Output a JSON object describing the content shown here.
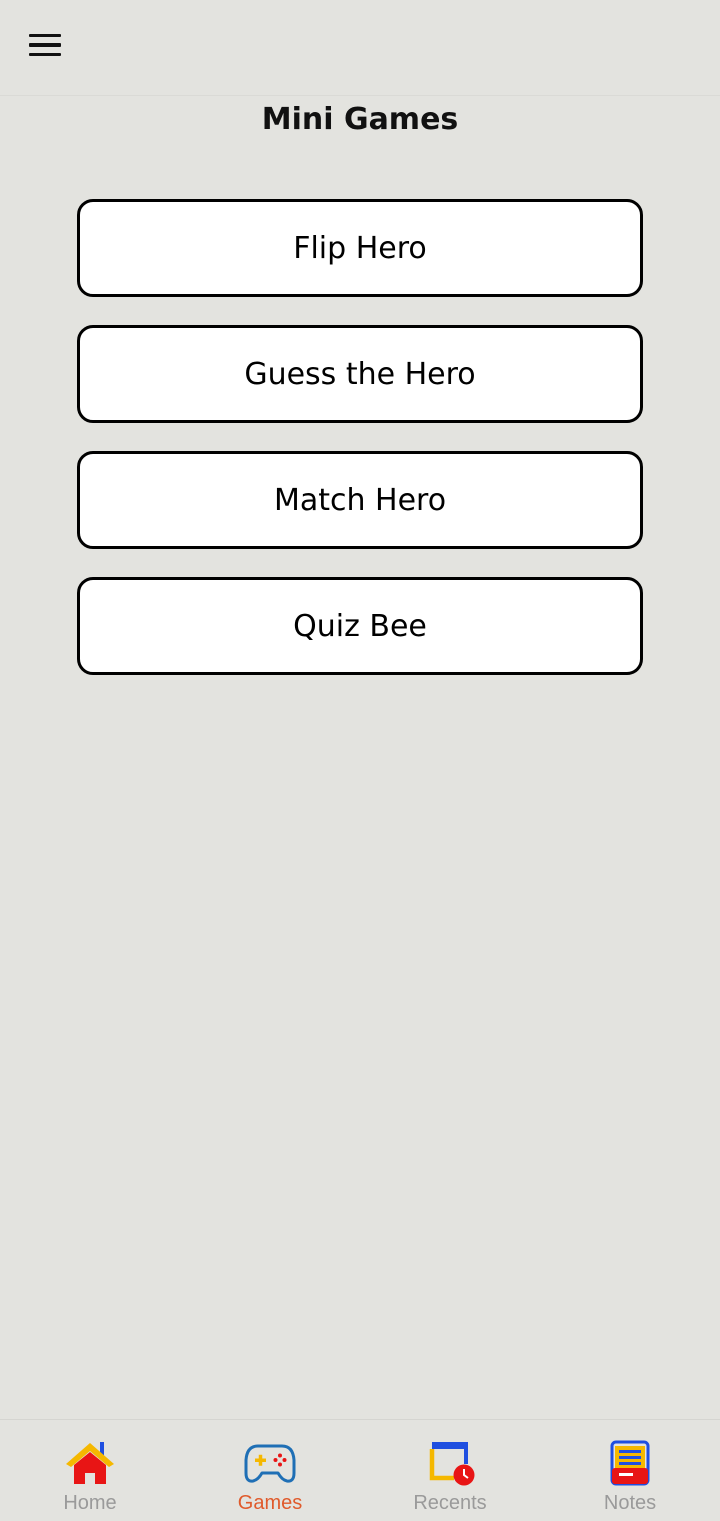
{
  "header": {
    "menu_icon": "hamburger-menu-icon"
  },
  "page": {
    "title": "Mini Games"
  },
  "games": [
    {
      "label": "Flip Hero"
    },
    {
      "label": "Guess the Hero"
    },
    {
      "label": "Match Hero"
    },
    {
      "label": "Quiz Bee"
    }
  ],
  "bottom_nav": {
    "active": "Games",
    "active_color": "#e05a2b",
    "inactive_color": "#9a9a9a",
    "items": [
      {
        "label": "Home",
        "icon": "home-icon"
      },
      {
        "label": "Games",
        "icon": "gamepad-icon"
      },
      {
        "label": "Recents",
        "icon": "recents-clock-icon"
      },
      {
        "label": "Notes",
        "icon": "notes-icon"
      }
    ]
  }
}
